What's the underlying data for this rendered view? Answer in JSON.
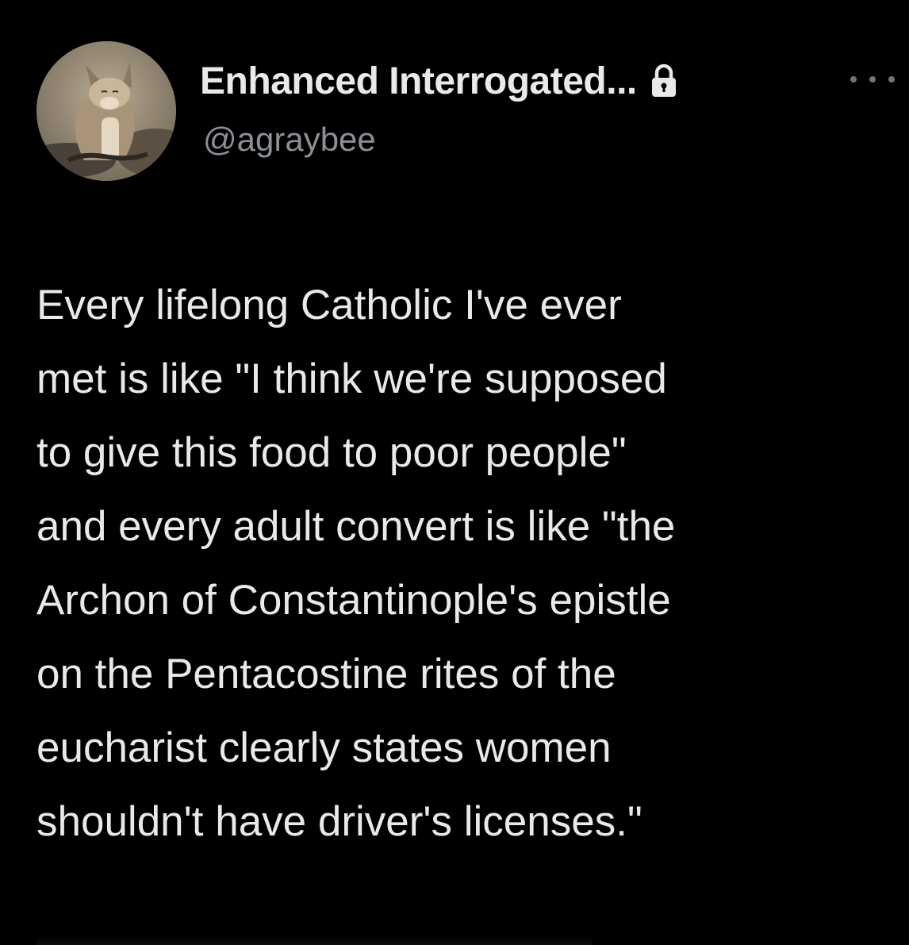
{
  "author": {
    "display_name": "Enhanced Interrogated...",
    "handle": "@agraybee",
    "avatar_icon": "fox-avatar",
    "protected_icon": "lock-icon"
  },
  "actions": {
    "more_icon": "more-horizontal-icon"
  },
  "tweet": {
    "lines": [
      "Every lifelong Catholic I've ever",
      "met is like \"I think we're supposed",
      "to give this food to poor people\"",
      "and every adult convert is like \"the",
      "Archon of Constantinople's epistle",
      "on the Pentacostine rites of the",
      "eucharist clearly states women",
      "shouldn't have driver's licenses.\""
    ]
  },
  "colors": {
    "background": "#000000",
    "primary_text": "#e7e9ea",
    "secondary_text": "#8b9096"
  }
}
